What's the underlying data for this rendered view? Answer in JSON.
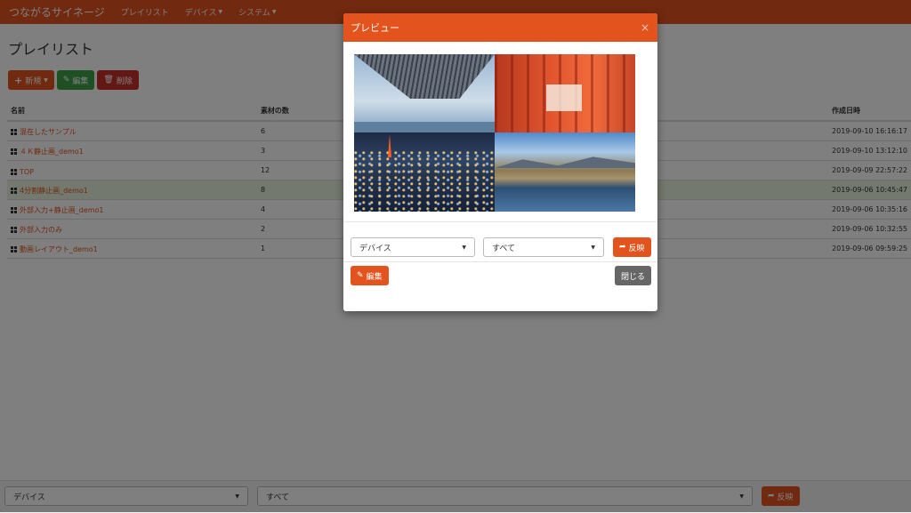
{
  "navbar": {
    "brand": "つながるサイネージ",
    "items": [
      {
        "label": "プレイリスト",
        "dropdown": false
      },
      {
        "label": "デバイス",
        "dropdown": true
      },
      {
        "label": "システム",
        "dropdown": true
      }
    ]
  },
  "page": {
    "title": "プレイリスト",
    "toolbar": {
      "new_label": "新規",
      "edit_label": "編集",
      "delete_label": "削除"
    }
  },
  "table": {
    "headers": {
      "name": "名前",
      "count": "素材の数",
      "created": "作成日時"
    },
    "rows": [
      {
        "name": "混在したサンプル",
        "count": "6",
        "created": "2019-09-10 16:16:17"
      },
      {
        "name": "４Ｋ静止画_demo1",
        "count": "3",
        "created": "2019-09-10 13:12:10"
      },
      {
        "name": "TOP",
        "count": "12",
        "created": "2019-09-09 22:57:22"
      },
      {
        "name": "4分割静止画_demo1",
        "count": "8",
        "created": "2019-09-06 10:45:47",
        "highlighted": true
      },
      {
        "name": "外部入力+静止画_demo1",
        "count": "4",
        "created": "2019-09-06 10:35:16"
      },
      {
        "name": "外部入力のみ",
        "count": "2",
        "created": "2019-09-06 10:32:55"
      },
      {
        "name": "動画レイアウト_demo1",
        "count": "1",
        "created": "2019-09-06 09:59:25"
      }
    ]
  },
  "footer": {
    "device_select": "デバイス",
    "filter_select": "すべて",
    "apply_label": "反映"
  },
  "modal": {
    "title": "プレビュー",
    "close": "×",
    "device_select": "デバイス",
    "filter_select": "すべて",
    "apply_label": "反映",
    "edit_label": "編集",
    "close_label": "閉じる"
  },
  "colors": {
    "accent": "#e2531e",
    "success": "#3fa048",
    "danger": "#c9302c",
    "row_highlight": "#e6f3dd"
  },
  "icons": [
    "plus-icon",
    "edit-icon",
    "trash-icon",
    "grid-icon",
    "share-icon",
    "caret-down-icon",
    "close-icon"
  ]
}
